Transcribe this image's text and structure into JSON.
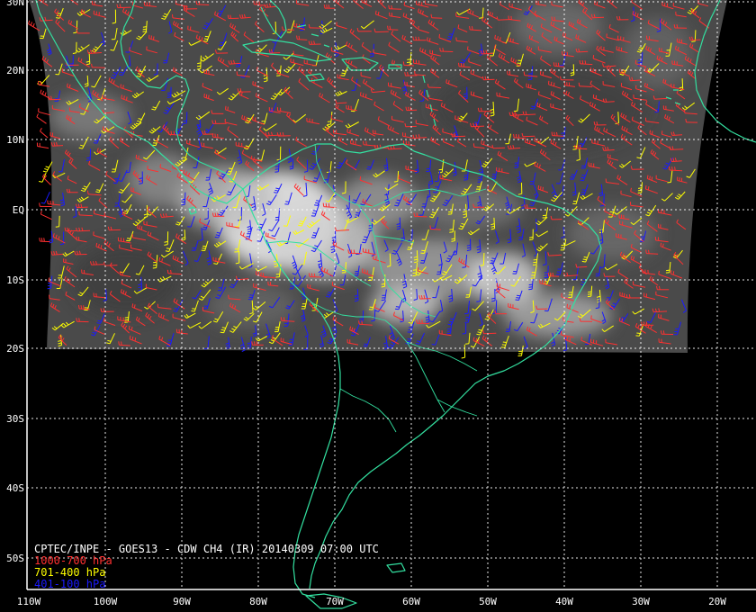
{
  "title": "CPTEC/INPE - GOES13 - CDW CH4 (IR) 20140309 07:00 UTC",
  "legend": [
    {
      "label": "1000-700 hPa",
      "color": "#ff3030"
    },
    {
      "label": "701-400 hPa",
      "color": "#ffff00"
    },
    {
      "label": "401-100 hPa",
      "color": "#1a1aff"
    }
  ],
  "colors": {
    "background": "#000000",
    "coastline": "#33e0a0",
    "grid": "#ffffff",
    "frame": "#ffffff"
  },
  "axes": {
    "longitude_labels": [
      "110W",
      "100W",
      "90W",
      "80W",
      "70W",
      "60W",
      "50W",
      "40W",
      "30W",
      "20W"
    ],
    "latitude_labels": [
      "30N",
      "20N",
      "10N",
      "EQ",
      "10S",
      "20S",
      "30S",
      "40S",
      "50S"
    ]
  }
}
